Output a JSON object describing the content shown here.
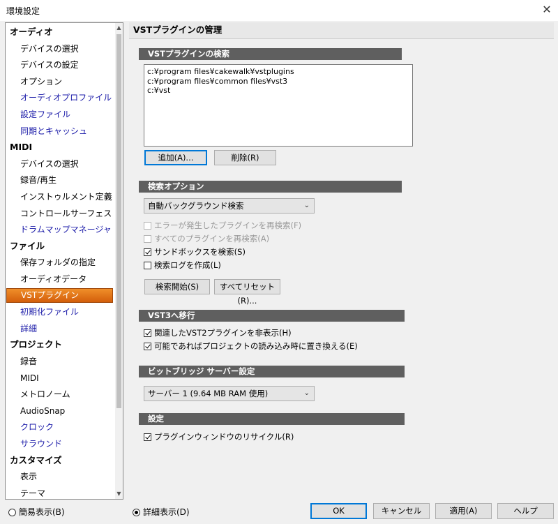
{
  "window": {
    "title": "環境設定",
    "close": "✕"
  },
  "nav": {
    "items": [
      {
        "label": "オーディオ",
        "type": "head"
      },
      {
        "label": "デバイスの選択",
        "type": "sub"
      },
      {
        "label": "デバイスの設定",
        "type": "sub"
      },
      {
        "label": "オプション",
        "type": "sub"
      },
      {
        "label": "オーディオプロファイル",
        "type": "sub",
        "style": "blue"
      },
      {
        "label": "設定ファイル",
        "type": "sub",
        "style": "blue"
      },
      {
        "label": "同期とキャッシュ",
        "type": "sub",
        "style": "blue"
      },
      {
        "label": "MIDI",
        "type": "head"
      },
      {
        "label": "デバイスの選択",
        "type": "sub"
      },
      {
        "label": "録音/再生",
        "type": "sub"
      },
      {
        "label": "インストゥルメント定義",
        "type": "sub"
      },
      {
        "label": "コントロールサーフェス",
        "type": "sub"
      },
      {
        "label": "ドラムマップマネージャ",
        "type": "sub",
        "style": "blue"
      },
      {
        "label": "ファイル",
        "type": "head"
      },
      {
        "label": "保存フォルダの指定",
        "type": "sub"
      },
      {
        "label": "オーディオデータ",
        "type": "sub"
      },
      {
        "label": "VSTプラグイン",
        "type": "sub",
        "style": "sel"
      },
      {
        "label": "初期化ファイル",
        "type": "sub",
        "style": "blue"
      },
      {
        "label": "詳細",
        "type": "sub",
        "style": "blue"
      },
      {
        "label": "プロジェクト",
        "type": "head"
      },
      {
        "label": "録音",
        "type": "sub"
      },
      {
        "label": "MIDI",
        "type": "sub"
      },
      {
        "label": "メトロノーム",
        "type": "sub"
      },
      {
        "label": "AudioSnap",
        "type": "sub"
      },
      {
        "label": "クロック",
        "type": "sub",
        "style": "blue"
      },
      {
        "label": "サラウンド",
        "type": "sub",
        "style": "blue"
      },
      {
        "label": "カスタマイズ",
        "type": "head"
      },
      {
        "label": "表示",
        "type": "sub"
      },
      {
        "label": "テーマ",
        "type": "sub"
      }
    ],
    "scroll_up": "▲",
    "scroll_down": "▼"
  },
  "panel": {
    "title": "VSTプラグインの管理",
    "search_section": {
      "title": "VSTプラグインの検索",
      "paths": [
        "c:¥program files¥cakewalk¥vstplugins",
        "c:¥program files¥common files¥vst3",
        "c:¥vst"
      ],
      "add_button": "追加(A)...",
      "delete_button": "削除(R)"
    },
    "options_section": {
      "title": "検索オプション",
      "mode_value": "自動バックグラウンド検索",
      "checks": [
        {
          "label": "エラーが発生したプラグインを再検索(F)",
          "checked": false,
          "disabled": true
        },
        {
          "label": "すべてのプラグインを再検索(A)",
          "checked": false,
          "disabled": true
        },
        {
          "label": "サンドボックスを検索(S)",
          "checked": true,
          "disabled": false
        },
        {
          "label": "検索ログを作成(L)",
          "checked": false,
          "disabled": false
        }
      ],
      "start_button": "検索開始(S)",
      "reset_button": "すべてリセット(R)..."
    },
    "vst3_section": {
      "title": "VST3へ移行",
      "checks": [
        {
          "label": "関連したVST2プラグインを非表示(H)",
          "checked": true
        },
        {
          "label": "可能であればプロジェクトの読み込み時に置き換える(E)",
          "checked": true
        }
      ]
    },
    "bitbridge_section": {
      "title": "ビットブリッジ サーバー設定",
      "server_value": "サーバー 1 (9.64  MB RAM 使用)"
    },
    "settings_section": {
      "title": "設定",
      "checks": [
        {
          "label": "プラグインウィンドウのリサイクル(R)",
          "checked": true
        }
      ]
    }
  },
  "footer": {
    "simple_view": "簡易表示(B)",
    "detailed_view": "詳細表示(D)",
    "selected_view": "detailed",
    "ok": "OK",
    "cancel": "キャンセル",
    "apply": "適用(A)",
    "help": "ヘルプ"
  }
}
